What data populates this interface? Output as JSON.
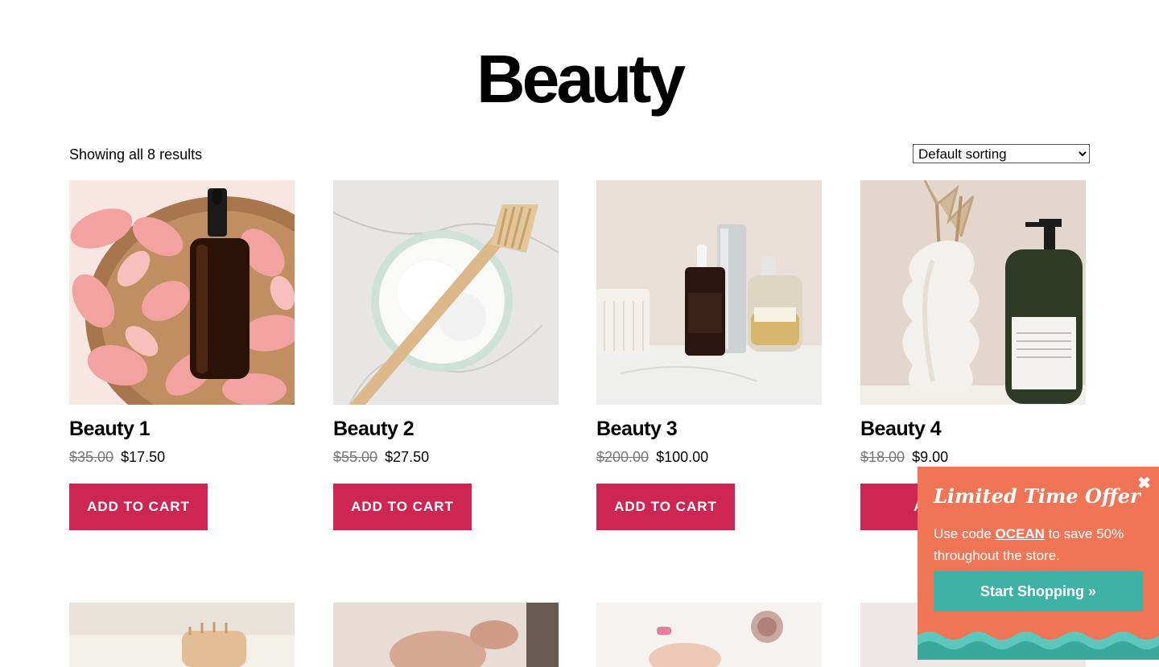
{
  "page": {
    "title": "Beauty"
  },
  "toolbar": {
    "result_count": "Showing all 8 results",
    "sort_selected": "Default sorting"
  },
  "products": [
    {
      "name": "Beauty 1",
      "regular_price": "$35.00",
      "sale_price": "$17.50",
      "button": "ADD TO CART"
    },
    {
      "name": "Beauty 2",
      "regular_price": "$55.00",
      "sale_price": "$27.50",
      "button": "ADD TO CART"
    },
    {
      "name": "Beauty 3",
      "regular_price": "$200.00",
      "sale_price": "$100.00",
      "button": "ADD TO CART"
    },
    {
      "name": "Beauty 4",
      "regular_price": "$18.00",
      "sale_price": "$9.00",
      "button": "ADD"
    }
  ],
  "popup": {
    "close": "✖",
    "title": "Limited Time Offer",
    "text_before": "Use code ",
    "code": "OCEAN",
    "text_after": " to save 50% throughout the store.",
    "button": "Start Shopping »"
  },
  "colors": {
    "accent": "#cd2653",
    "popup_bg": "#f07557",
    "popup_button": "#3fb2a6"
  }
}
